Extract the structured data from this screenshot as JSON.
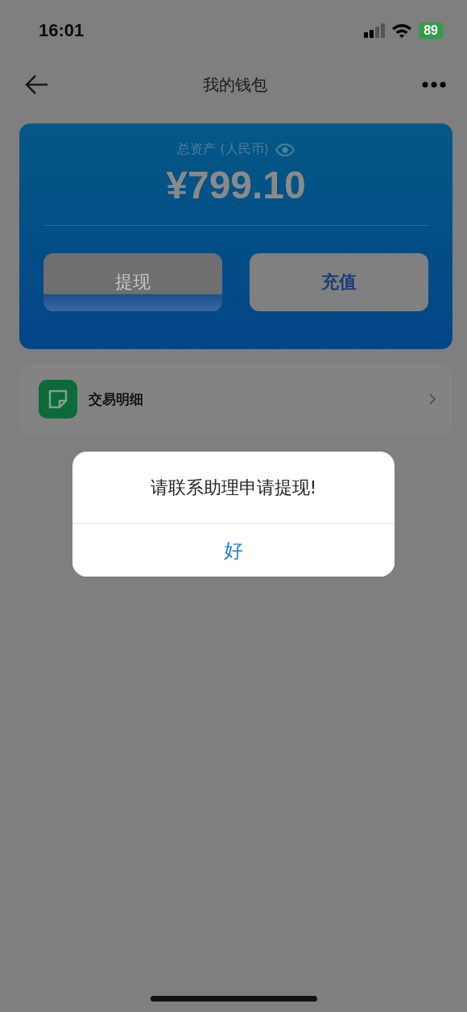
{
  "status_bar": {
    "time": "16:01",
    "battery": "89"
  },
  "nav": {
    "title": "我的钱包"
  },
  "wallet": {
    "label": "总资产 (人民币)",
    "amount": "¥799.10",
    "buttons": [
      {
        "label": "提现",
        "kind": "withdraw"
      },
      {
        "label": "充值",
        "kind": "recharge"
      }
    ]
  },
  "menu": [
    {
      "label": "交易明细"
    }
  ],
  "dialog": {
    "message": "请联系助理申请提现!",
    "button": "好"
  }
}
